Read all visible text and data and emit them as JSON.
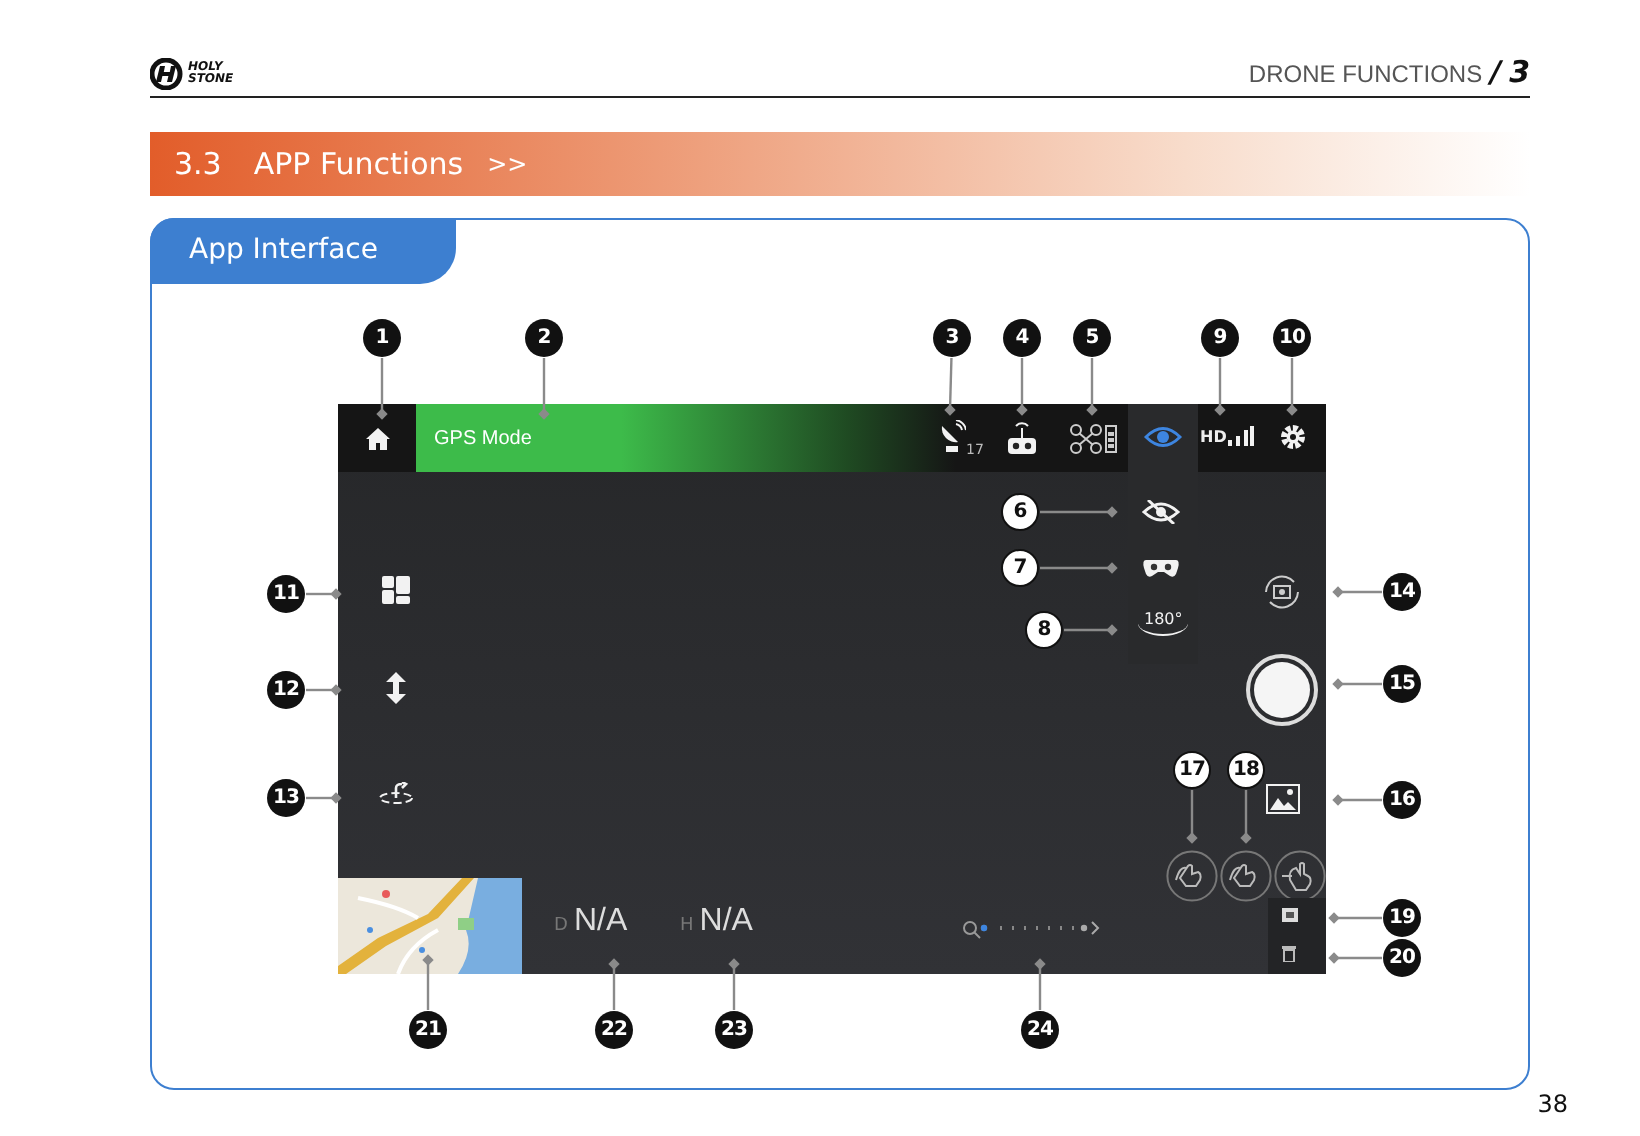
{
  "header": {
    "logo_top": "HOLY",
    "logo_bottom": "STONE",
    "chapter": "DRONE FUNCTIONS",
    "separator": "/",
    "chapter_number": "3"
  },
  "section": {
    "number": "3.3",
    "title": "APP Functions",
    "chevrons": ">>"
  },
  "card": {
    "tab": "App Interface"
  },
  "app": {
    "mode": "GPS Mode",
    "satellites": "17",
    "hd": "HD",
    "distance_label": "D",
    "distance": "N/A",
    "height_label": "H",
    "height": "N/A",
    "panorama": "180°",
    "zoom": {
      "level": 0
    }
  },
  "callouts": [
    {
      "number": "1",
      "kind": "filled"
    },
    {
      "number": "2",
      "kind": "filled"
    },
    {
      "number": "3",
      "kind": "filled"
    },
    {
      "number": "4",
      "kind": "filled"
    },
    {
      "number": "5",
      "kind": "filled"
    },
    {
      "number": "9",
      "kind": "filled"
    },
    {
      "number": "10",
      "kind": "filled"
    },
    {
      "number": "6",
      "kind": "outlined"
    },
    {
      "number": "7",
      "kind": "outlined"
    },
    {
      "number": "8",
      "kind": "outlined"
    },
    {
      "number": "11",
      "kind": "filled"
    },
    {
      "number": "12",
      "kind": "filled"
    },
    {
      "number": "13",
      "kind": "filled"
    },
    {
      "number": "14",
      "kind": "filled"
    },
    {
      "number": "15",
      "kind": "filled"
    },
    {
      "number": "16",
      "kind": "filled"
    },
    {
      "number": "17",
      "kind": "outlined"
    },
    {
      "number": "18",
      "kind": "outlined"
    },
    {
      "number": "19",
      "kind": "filled"
    },
    {
      "number": "20",
      "kind": "filled"
    },
    {
      "number": "21",
      "kind": "filled"
    },
    {
      "number": "22",
      "kind": "filled"
    },
    {
      "number": "23",
      "kind": "filled"
    },
    {
      "number": "24",
      "kind": "filled"
    }
  ],
  "page_number": "38"
}
